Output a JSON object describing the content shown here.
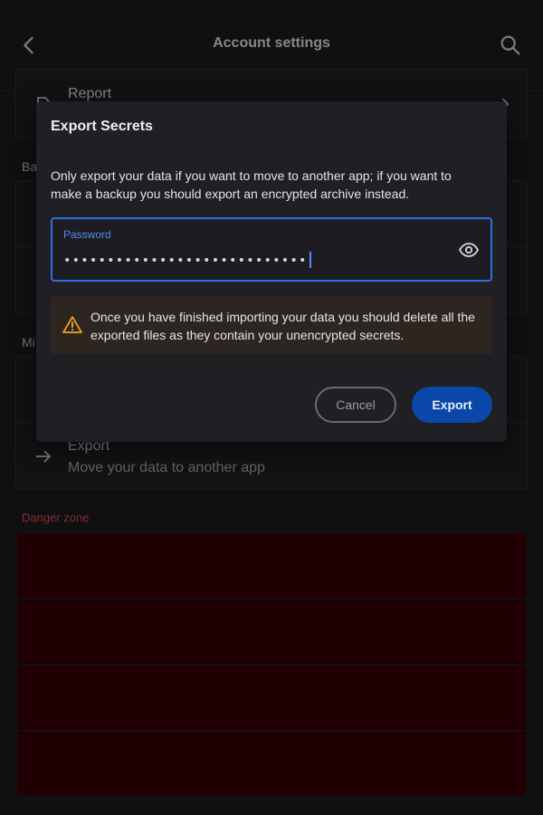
{
  "appbar": {
    "title": "Account settings",
    "back_icon": "chevron-left-icon",
    "search_icon": "search-icon"
  },
  "background": {
    "report": {
      "title": "Report"
    },
    "section_backup_label": "Ba",
    "section_misc_label": "Mi",
    "export": {
      "title": "Export",
      "subtitle": "Move your data to another app"
    },
    "danger_label": "Danger zone"
  },
  "dialog": {
    "title": "Export Secrets",
    "body": "Only export your data if you want to move to another app; if you want to make a backup you should export an encrypted archive instead.",
    "password": {
      "label": "Password",
      "value": "••••••••••••••••••••••••••••"
    },
    "warning": {
      "text": "Once you have finished importing your data you should delete all the exported files as they contain your unencrypted secrets."
    },
    "buttons": {
      "cancel": "Cancel",
      "export": "Export"
    }
  },
  "colors": {
    "accent": "#2f6ee0",
    "primary_button": "#0a47a8",
    "danger": "#3a0006",
    "warning_icon": "#f0a020"
  }
}
